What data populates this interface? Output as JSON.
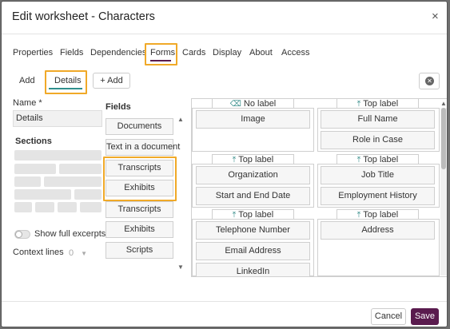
{
  "dialog": {
    "title": "Edit worksheet - Characters",
    "close_glyph": "×"
  },
  "tabs": [
    "Properties",
    "Fields",
    "Dependencies",
    "Forms",
    "Cards",
    "Display",
    "About",
    "Access"
  ],
  "subtabs": {
    "add": "Add",
    "details": "Details",
    "add_button": "+ Add"
  },
  "form": {
    "name_label": "Name *",
    "name_value": "Details",
    "sections_label": "Sections",
    "fields_label": "Fields",
    "show_excerpts_label": "Show full excerpts",
    "context_lines_label": "Context lines",
    "context_lines_value": "0"
  },
  "fields_list": [
    "Documents",
    "Text in a document",
    "Transcripts",
    "Exhibits",
    "Transcripts",
    "Exhibits",
    "Scripts"
  ],
  "cards": [
    {
      "header": "No label",
      "icon": "no-label-icon",
      "fields": [
        "Image"
      ]
    },
    {
      "header": "Top label",
      "icon": "top-label-icon",
      "fields": [
        "Full Name",
        "Role in Case"
      ]
    },
    {
      "header": "Top label",
      "icon": "top-label-icon",
      "fields": [
        "Organization",
        "Start and End Date"
      ]
    },
    {
      "header": "Top label",
      "icon": "top-label-icon",
      "fields": [
        "Job Title",
        "Employment History"
      ]
    },
    {
      "header": "Top label",
      "icon": "top-label-icon",
      "fields": [
        "Telephone Number",
        "Email Address",
        "LinkedIn"
      ]
    },
    {
      "header": "Top label",
      "icon": "top-label-icon",
      "fields": [
        "Address"
      ]
    }
  ],
  "footer": {
    "cancel": "Cancel",
    "save": "Save"
  },
  "colors": {
    "accent": "#5a1b4e",
    "teal": "#2f8f8c",
    "highlight": "#f0a928"
  }
}
